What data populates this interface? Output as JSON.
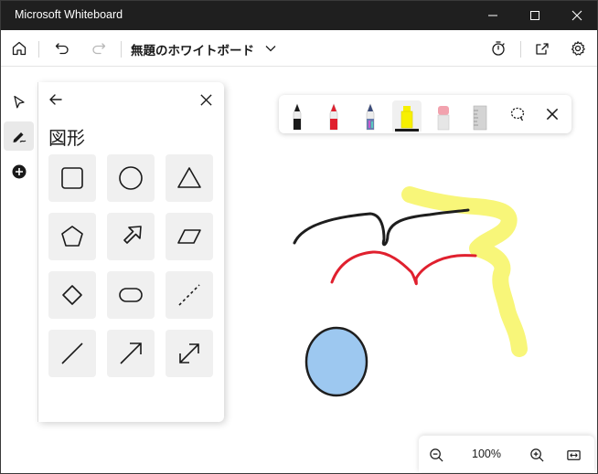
{
  "window": {
    "title": "Microsoft Whiteboard",
    "controls": [
      "minimize-icon",
      "maximize-icon",
      "close-icon"
    ]
  },
  "appbar": {
    "doc_title": "無題のホワイトボード",
    "buttons": [
      "home-icon",
      "undo-icon",
      "redo-icon",
      "timer-icon",
      "share-icon",
      "settings-icon"
    ]
  },
  "left_tools": [
    "select-icon",
    "inking-icon",
    "add-icon"
  ],
  "shapes_panel": {
    "title": "図形",
    "shapes": [
      "square",
      "circle",
      "triangle",
      "pentagon",
      "arrow-block",
      "parallelogram",
      "diamond",
      "rounded-rectangle",
      "dashed-line",
      "line",
      "arrow",
      "double-arrow"
    ]
  },
  "ink_toolbar": {
    "tools": [
      {
        "name": "black-pen",
        "color": "#1a1a1a"
      },
      {
        "name": "red-pen",
        "color": "#e0202e"
      },
      {
        "name": "galaxy-pen",
        "color": "#6a7fb0"
      },
      {
        "name": "highlighter",
        "color": "#f7f000",
        "active": true
      },
      {
        "name": "eraser",
        "color": "#f2a2ae"
      },
      {
        "name": "ruler",
        "color": "#c8c8c8"
      }
    ],
    "buttons": [
      "lasso-icon",
      "close-icon"
    ]
  },
  "canvas": {
    "strokes": [
      {
        "name": "black-stroke",
        "color": "#1e1e1e"
      },
      {
        "name": "red-stroke",
        "color": "#e0202e"
      },
      {
        "name": "yellow-highlight",
        "color": "#f7f56a"
      },
      {
        "name": "blue-ellipse",
        "color": "#9dc8f0"
      }
    ]
  },
  "zoom": {
    "value": "100%"
  }
}
